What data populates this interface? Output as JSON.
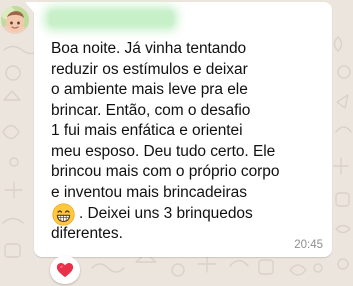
{
  "chat": {
    "sender_name": "",
    "message": {
      "lines": [
        "Boa noite. Já vinha tentando",
        "reduzir os estímulos e deixar",
        "o ambiente mais leve pra ele",
        "brincar. Então, com o desafio",
        "1 fui mais enfática e orientei",
        "meu esposo. Deu tudo certo. Ele",
        "brincou mais com o próprio corpo",
        "e inventou mais brincadeiras"
      ],
      "emoji": "grinning-face-emoji",
      "emoji_line_text": ". Deixei uns 3 brinquedos",
      "last_line": "diferentes.",
      "time": "20:45"
    },
    "reaction": {
      "icon": "red-heart-icon",
      "color": "#e8304a"
    }
  },
  "colors": {
    "wallpaper": "#ece5dd",
    "bubble": "#ffffff",
    "text": "#111111",
    "timestamp": "#8f8f8f",
    "sender_name_blur": "#c7f0c9"
  }
}
